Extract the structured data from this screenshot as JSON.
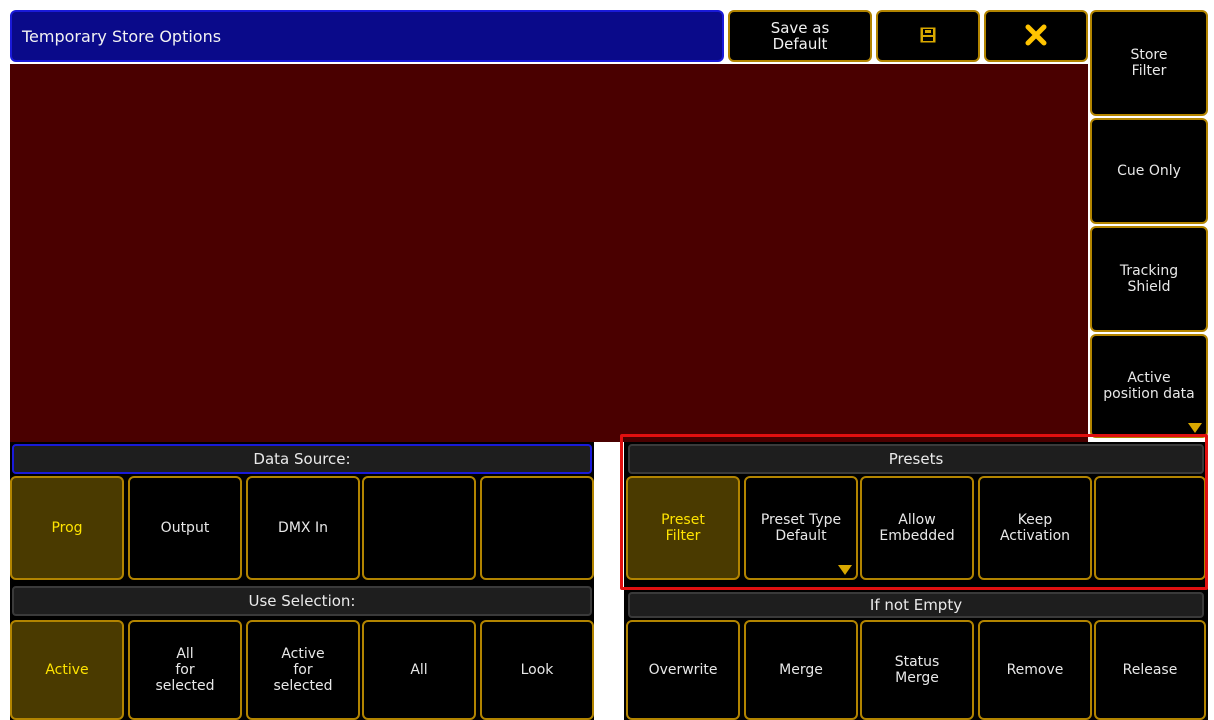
{
  "title": "Temporary Store Options",
  "top_buttons": {
    "save_default": "Save as\nDefault",
    "save_icon": "floppy-disk-icon",
    "close_icon": "close-x-icon"
  },
  "side_buttons": [
    "Store\nFilter",
    "Cue Only",
    "Tracking\nShield",
    "Active\nposition data"
  ],
  "data_source": {
    "header": "Data Source:",
    "buttons": [
      "Prog",
      "Output",
      "DMX In",
      "",
      ""
    ],
    "active": "Prog"
  },
  "presets": {
    "header": "Presets",
    "buttons": [
      "Preset\nFilter",
      "Preset Type\nDefault",
      "Allow\nEmbedded",
      "Keep\nActivation",
      ""
    ],
    "active": "Preset\nFilter"
  },
  "use_selection": {
    "header": "Use Selection:",
    "buttons": [
      "Active",
      "All\nfor\nselected",
      "Active\nfor\nselected",
      "All",
      "Look"
    ],
    "active": "Active"
  },
  "if_not_empty": {
    "header": "If not Empty",
    "buttons": [
      "Overwrite",
      "Merge",
      "Status\nMerge",
      "Remove",
      "Release"
    ]
  },
  "colors": {
    "title_bar": "#0a0a8a",
    "area": "#4a0000",
    "button_border": "#b28400",
    "active_text": "#ffe400",
    "highlight": "#e01010"
  }
}
